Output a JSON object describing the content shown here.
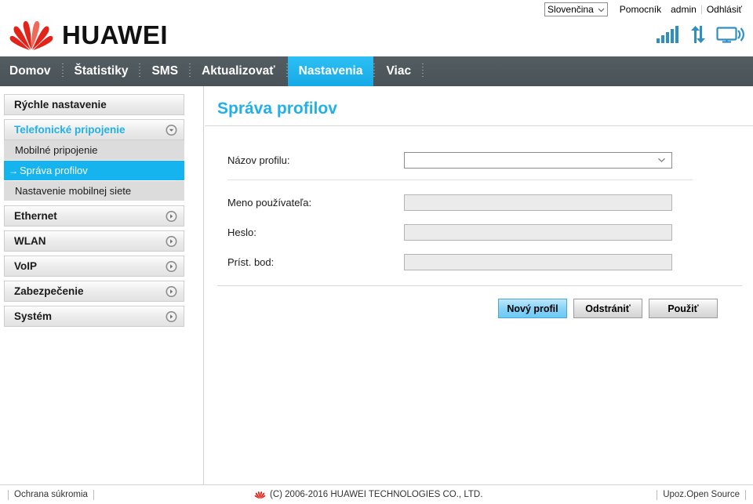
{
  "topbar": {
    "language": "Slovenčina",
    "language_icon": "chevron-down-icon",
    "help_label": "Pomocník",
    "user_label": "admin",
    "logout_label": "Odhlásiť"
  },
  "brand": {
    "wordmark": "HUAWEI",
    "logo_icon": "huawei-flower-logo",
    "logo_color": "#e2231a"
  },
  "status_icons": [
    {
      "name": "signal-bars-icon",
      "label": "Signal"
    },
    {
      "name": "data-transfer-arrows-icon",
      "label": "Prenos dát"
    },
    {
      "name": "connected-device-icon",
      "label": "Pripojenie"
    }
  ],
  "nav": {
    "items": [
      {
        "label": "Domov",
        "active": false
      },
      {
        "label": "Štatistiky",
        "active": false
      },
      {
        "label": "SMS",
        "active": false
      },
      {
        "label": "Aktualizovať",
        "active": false
      },
      {
        "label": "Nastavenia",
        "active": true
      },
      {
        "label": "Viac",
        "active": false
      }
    ],
    "active_color": "#20b4ee",
    "bar_color": "#4d575b"
  },
  "sidebar": {
    "quick": {
      "label": "Rýchle nastavenie"
    },
    "dialup": {
      "label": "Telefonické pripojenie",
      "toggle_icon": "chevron-down-circle-icon",
      "expanded": true,
      "items": [
        {
          "label": "Mobilné pripojenie",
          "active": false
        },
        {
          "label": "Správa profilov",
          "active": true,
          "marker": "→"
        },
        {
          "label": "Nastavenie mobilnej siete",
          "active": false
        }
      ]
    },
    "groups": [
      {
        "label": "Ethernet",
        "toggle_icon": "chevron-right-circle-icon"
      },
      {
        "label": "WLAN",
        "toggle_icon": "chevron-right-circle-icon"
      },
      {
        "label": "VoIP",
        "toggle_icon": "chevron-right-circle-icon"
      },
      {
        "label": "Zabezpečenie",
        "toggle_icon": "chevron-right-circle-icon"
      },
      {
        "label": "Systém",
        "toggle_icon": "chevron-right-circle-icon"
      }
    ]
  },
  "main": {
    "title": "Správa profilov",
    "fields": {
      "profile_name": {
        "label": "Názov profilu:",
        "value": "",
        "icon": "chevron-down-icon"
      },
      "username": {
        "label": "Meno používateľa:",
        "value": "",
        "disabled": true
      },
      "password": {
        "label": "Heslo:",
        "value": "",
        "disabled": true
      },
      "apn": {
        "label": "Príst. bod:",
        "value": "",
        "disabled": true
      }
    },
    "buttons": {
      "new_profile": "Nový profil",
      "delete": "Odstrániť",
      "apply": "Použiť"
    }
  },
  "footer": {
    "privacy_label": "Ochrana súkromia",
    "copyright": "(C) 2006-2016 HUAWEI TECHNOLOGIES CO., LTD.",
    "opensource_label": "Upoz.Open Source",
    "logo_icon": "huawei-flower-logo"
  }
}
